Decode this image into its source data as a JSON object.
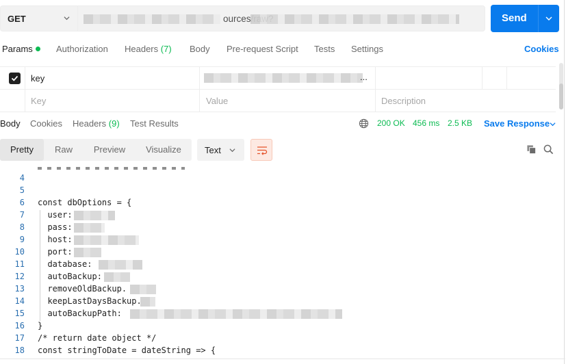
{
  "request": {
    "method": "GET",
    "url_visible": "ources/raw?",
    "send_label": "Send"
  },
  "request_tabs": {
    "params": "Params",
    "authorization": "Authorization",
    "headers": "Headers",
    "headers_count": "(7)",
    "body": "Body",
    "prerequest": "Pre-request Script",
    "tests": "Tests",
    "settings": "Settings",
    "cookies": "Cookies"
  },
  "params": {
    "row1": {
      "checked": true,
      "key": "key",
      "value": "..."
    },
    "placeholders": {
      "key": "Key",
      "value": "Value",
      "description": "Description"
    }
  },
  "response_tabs": {
    "body": "Body",
    "cookies": "Cookies",
    "headers": "Headers",
    "headers_count": "(9)",
    "test_results": "Test Results"
  },
  "response_meta": {
    "status": "200 OK",
    "time": "456 ms",
    "size": "2.5 KB",
    "save_response": "Save Response"
  },
  "view": {
    "pretty": "Pretty",
    "raw": "Raw",
    "preview": "Preview",
    "visualize": "Visualize",
    "format": "Text"
  },
  "code": {
    "lines": [
      {
        "n": "4",
        "text": ""
      },
      {
        "n": "5",
        "text": ""
      },
      {
        "n": "6",
        "text": "const dbOptions = {"
      },
      {
        "n": "7",
        "text": "  user:"
      },
      {
        "n": "8",
        "text": "  pass:"
      },
      {
        "n": "9",
        "text": "  host:"
      },
      {
        "n": "10",
        "text": "  port:"
      },
      {
        "n": "11",
        "text": "  database:"
      },
      {
        "n": "12",
        "text": "  autoBackup:"
      },
      {
        "n": "13",
        "text": "  removeOldBackup."
      },
      {
        "n": "14",
        "text": "  keepLastDaysBackup."
      },
      {
        "n": "15",
        "text": "  autoBackupPath:"
      },
      {
        "n": "16",
        "text": "}"
      },
      {
        "n": "17",
        "text": "/* return date object */"
      },
      {
        "n": "18",
        "text": "const stringToDate = dateString => {"
      }
    ]
  },
  "colors": {
    "accent": "#097bed",
    "success": "#0cbb52",
    "line_numbers": "#2a6fb0",
    "wrap_active": "#fde9e2"
  }
}
